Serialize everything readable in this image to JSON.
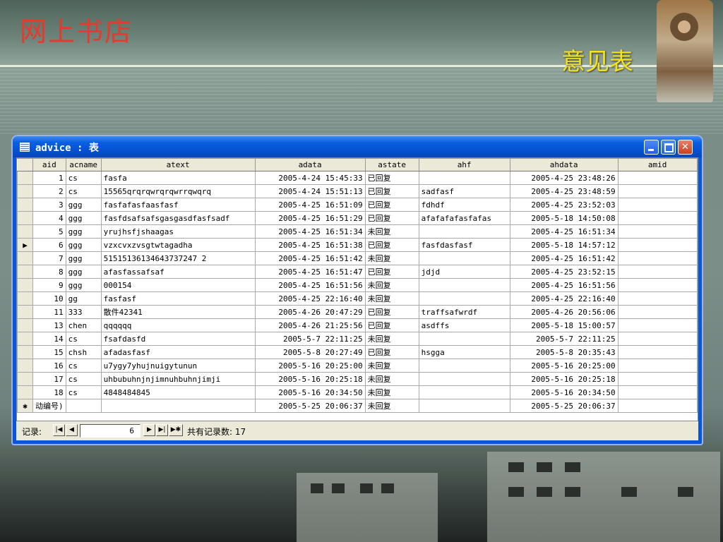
{
  "slide": {
    "site_title": "网上书店",
    "page_title": "意见表"
  },
  "window": {
    "title": "advice : 表",
    "columns": [
      "aid",
      "acname",
      "atext",
      "adata",
      "astate",
      "ahf",
      "ahdata",
      "amid"
    ],
    "rows": [
      {
        "aid": "1",
        "acname": "cs",
        "atext": "fasfa",
        "adata": "2005-4-24 15:45:33",
        "astate": "已回复",
        "ahf": "",
        "ahdata": "2005-4-25 23:48:26",
        "amid": ""
      },
      {
        "aid": "2",
        "acname": "cs",
        "atext": "15565qrqrqwrqrqwrrqwqrq",
        "adata": "2005-4-24 15:51:13",
        "astate": "已回复",
        "ahf": "sadfasf",
        "ahdata": "2005-4-25 23:48:59",
        "amid": ""
      },
      {
        "aid": "3",
        "acname": "ggg",
        "atext": "fasfafasfaasfasf",
        "adata": "2005-4-25 16:51:09",
        "astate": "已回复",
        "ahf": "fdhdf",
        "ahdata": "2005-4-25 23:52:03",
        "amid": ""
      },
      {
        "aid": "4",
        "acname": "ggg",
        "atext": "fasfdsafsafsgasgasdfasfsadf",
        "adata": "2005-4-25 16:51:29",
        "astate": "已回复",
        "ahf": "afafafafasfafas",
        "ahdata": "2005-5-18 14:50:08",
        "amid": ""
      },
      {
        "aid": "5",
        "acname": "ggg",
        "atext": "yrujhsfjshaagas",
        "adata": "2005-4-25 16:51:34",
        "astate": "未回复",
        "ahf": "",
        "ahdata": "2005-4-25 16:51:34",
        "amid": ""
      },
      {
        "aid": "6",
        "acname": "ggg",
        "atext": "vzxcvxzvsgtwtagadha",
        "adata": "2005-4-25 16:51:38",
        "astate": "已回复",
        "ahf": "fasfdasfasf",
        "ahdata": "2005-5-18 14:57:12",
        "amid": ""
      },
      {
        "aid": "7",
        "acname": "ggg",
        "atext": "51515136134643737247 2",
        "adata": "2005-4-25 16:51:42",
        "astate": "未回复",
        "ahf": "",
        "ahdata": "2005-4-25 16:51:42",
        "amid": ""
      },
      {
        "aid": "8",
        "acname": "ggg",
        "atext": "afasfassafsaf",
        "adata": "2005-4-25 16:51:47",
        "astate": "已回复",
        "ahf": "jdjd",
        "ahdata": "2005-4-25 23:52:15",
        "amid": ""
      },
      {
        "aid": "9",
        "acname": "ggg",
        "atext": "000154",
        "adata": "2005-4-25 16:51:56",
        "astate": "未回复",
        "ahf": "",
        "ahdata": "2005-4-25 16:51:56",
        "amid": ""
      },
      {
        "aid": "10",
        "acname": "gg",
        "atext": "fasfasf",
        "adata": "2005-4-25 22:16:40",
        "astate": "未回复",
        "ahf": "",
        "ahdata": "2005-4-25 22:16:40",
        "amid": ""
      },
      {
        "aid": "11",
        "acname": "333",
        "atext": "散件42341",
        "adata": "2005-4-26 20:47:29",
        "astate": "已回复",
        "ahf": "traffsafwrdf",
        "ahdata": "2005-4-26 20:56:06",
        "amid": ""
      },
      {
        "aid": "13",
        "acname": "chen",
        "atext": "qqqqqq",
        "adata": "2005-4-26 21:25:56",
        "astate": "已回复",
        "ahf": "asdffs",
        "ahdata": "2005-5-18 15:00:57",
        "amid": ""
      },
      {
        "aid": "14",
        "acname": "cs",
        "atext": "fsafdasfd",
        "adata": "2005-5-7 22:11:25",
        "astate": "未回复",
        "ahf": "",
        "ahdata": "2005-5-7 22:11:25",
        "amid": ""
      },
      {
        "aid": "15",
        "acname": "chsh",
        "atext": "afadasfasf",
        "adata": "2005-5-8 20:27:49",
        "astate": "已回复",
        "ahf": "hsgga",
        "ahdata": "2005-5-8 20:35:43",
        "amid": ""
      },
      {
        "aid": "16",
        "acname": "cs",
        "atext": "u7ygy7yhujnuigytunun",
        "adata": "2005-5-16 20:25:00",
        "astate": "未回复",
        "ahf": "",
        "ahdata": "2005-5-16 20:25:00",
        "amid": ""
      },
      {
        "aid": "17",
        "acname": "cs",
        "atext": "uhbubuhnjnjimnuhbuhnjimji",
        "adata": "2005-5-16 20:25:18",
        "astate": "未回复",
        "ahf": "",
        "ahdata": "2005-5-16 20:25:18",
        "amid": ""
      },
      {
        "aid": "18",
        "acname": "cs",
        "atext": "4848484845",
        "adata": "2005-5-16 20:34:50",
        "astate": "未回复",
        "ahf": "",
        "ahdata": "2005-5-16 20:34:50",
        "amid": ""
      }
    ],
    "new_row": {
      "selector": "✱",
      "aid": "动编号)",
      "adata": "2005-5-25 20:06:37",
      "astate": "未回复",
      "ahdata": "2005-5-25 20:06:37"
    },
    "current_row_selector": "▶",
    "current_row_index": 5
  },
  "nav": {
    "label": "记录:",
    "current_record": "6",
    "total_label": "共有记录数: 17",
    "first_icon": "first-record-icon",
    "prev_icon": "prev-record-icon",
    "next_icon": "next-record-icon",
    "last_icon": "last-record-icon",
    "new_icon": "new-record-icon"
  }
}
